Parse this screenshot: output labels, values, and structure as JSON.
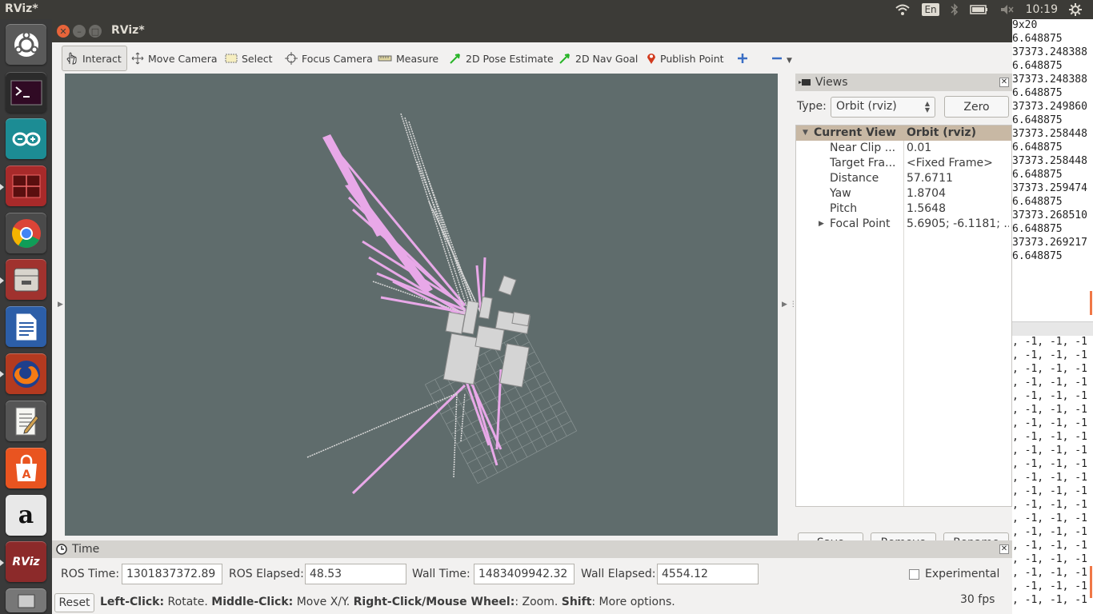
{
  "top_panel": {
    "app_title": "RViz*",
    "keyboard_layout": "En",
    "clock": "10:19"
  },
  "launcher": {
    "items": [
      "Ubuntu Dash",
      "Terminal",
      "Arduino IDE",
      "Terminator",
      "Google Chrome",
      "Files",
      "LibreOffice Writer",
      "Firefox",
      "Text Editor",
      "Ubuntu Software Center",
      "Amazon",
      "RViz"
    ]
  },
  "window": {
    "title": "RViz*"
  },
  "toolbar": {
    "interact": "Interact",
    "move_camera": "Move Camera",
    "select": "Select",
    "focus_camera": "Focus Camera",
    "measure": "Measure",
    "pose_estimate": "2D Pose Estimate",
    "nav_goal": "2D Nav Goal",
    "publish_point": "Publish Point"
  },
  "views": {
    "title": "Views",
    "type_label": "Type:",
    "type_value": "Orbit (rviz)",
    "zero_label": "Zero",
    "header_name": "Current View",
    "header_value": "Orbit (rviz)",
    "properties": [
      {
        "name": "Near Clip ...",
        "value": "0.01"
      },
      {
        "name": "Target Fra...",
        "value": "<Fixed Frame>"
      },
      {
        "name": "Distance",
        "value": "57.6711"
      },
      {
        "name": "Yaw",
        "value": "1.8704"
      },
      {
        "name": "Pitch",
        "value": "1.5648"
      },
      {
        "name": "Focal Point",
        "value": "5.6905; -6.1181; ..."
      }
    ],
    "save_label": "Save",
    "remove_label": "Remove",
    "rename_label": "Rename"
  },
  "time": {
    "title": "Time",
    "ros_time_label": "ROS Time:",
    "ros_time": "1301837372.89",
    "ros_elapsed_label": "ROS Elapsed:",
    "ros_elapsed": "48.53",
    "wall_time_label": "Wall Time:",
    "wall_time": "1483409942.32",
    "wall_elapsed_label": "Wall Elapsed:",
    "wall_elapsed": "4554.12",
    "experimental_label": "Experimental"
  },
  "status": {
    "reset_label": "Reset",
    "left_click": "Left-Click:",
    "left_click_desc": " Rotate. ",
    "middle_click": "Middle-Click:",
    "middle_click_desc": " Move X/Y. ",
    "right_click": "Right-Click/Mouse Wheel:",
    "right_click_desc": ": Zoom. ",
    "shift": "Shift",
    "shift_desc": ": More options.",
    "fps": "30 fps"
  },
  "terminal": {
    "top_lines": [
      "9x20",
      "6.648875",
      "37373.248388",
      "6.648875",
      "37373.248388",
      "6.648875",
      "37373.249860",
      "6.648875",
      "37373.258448",
      "6.648875",
      "37373.258448",
      "6.648875",
      "37373.259474",
      "6.648875",
      "37373.268510",
      "6.648875",
      "37373.269217",
      "6.648875"
    ],
    "bottom_line": ", -1, -1, -1"
  }
}
